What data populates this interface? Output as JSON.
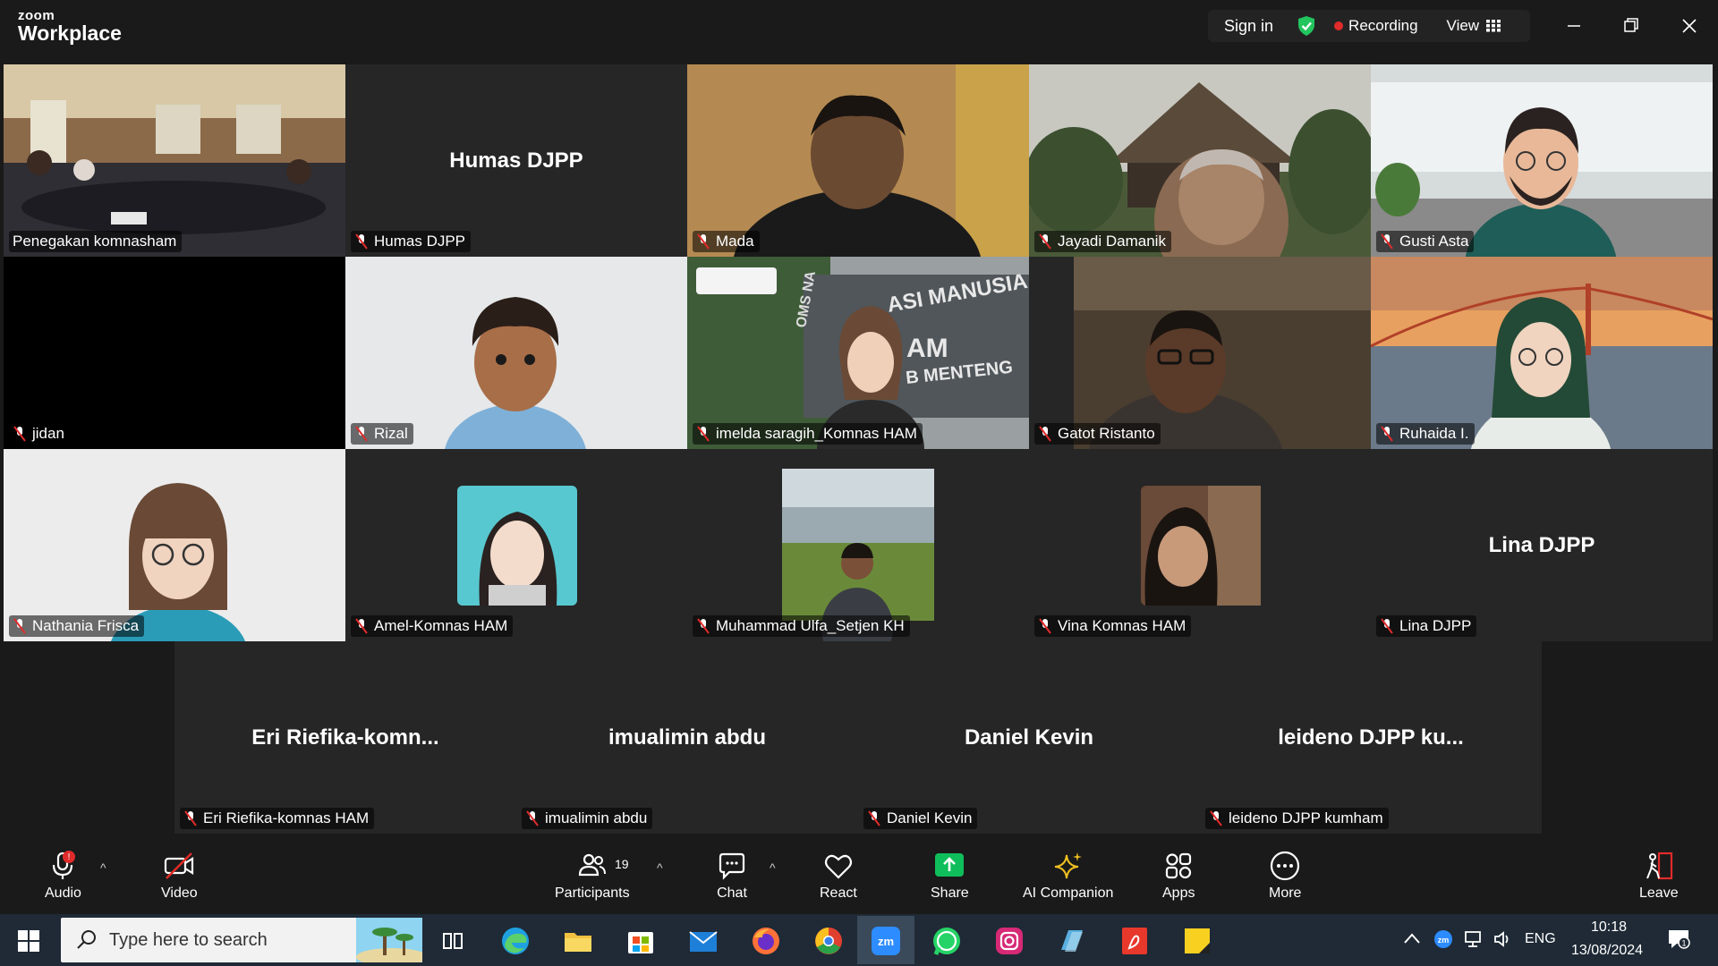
{
  "app": {
    "brand_small": "zoom",
    "brand_big": "Workplace"
  },
  "topbar": {
    "sign_in": "Sign in",
    "recording": "Recording",
    "view": "View"
  },
  "tiles": [
    {
      "name": "Penegakan komnasham",
      "big": "",
      "active": true
    },
    {
      "name": "Humas DJPP",
      "big": "Humas DJPP"
    },
    {
      "name": "Mada",
      "big": ""
    },
    {
      "name": "Jayadi Damanik",
      "big": ""
    },
    {
      "name": "Gusti Asta",
      "big": ""
    },
    {
      "name": "jidan",
      "big": ""
    },
    {
      "name": "Rizal",
      "big": ""
    },
    {
      "name": "imelda saragih_Komnas HAM",
      "big": ""
    },
    {
      "name": "Gatot Ristanto",
      "big": ""
    },
    {
      "name": "Ruhaida I.",
      "big": ""
    },
    {
      "name": "Nathania Frisca",
      "big": ""
    },
    {
      "name": "Amel-Komnas HAM",
      "big": ""
    },
    {
      "name": "Muhammad Ulfa_Setjen KH",
      "big": ""
    },
    {
      "name": "Vina Komnas HAM",
      "big": ""
    },
    {
      "name": "Lina DJPP",
      "big": "Lina DJPP"
    }
  ],
  "bottom_tiles": [
    {
      "name": "Eri Riefika-komnas HAM",
      "big": "Eri  Riefika-komn..."
    },
    {
      "name": "imualimin abdu",
      "big": "imualimin abdu"
    },
    {
      "name": "Daniel Kevin",
      "big": "Daniel Kevin"
    },
    {
      "name": "leideno DJPP kumham",
      "big": "leideno DJPP  ku..."
    }
  ],
  "imelda_sign": {
    "line1": "ASI MANUSIA",
    "line2": "AM",
    "line3": "B MENTENG",
    "left": "OMS NA"
  },
  "toolbar": {
    "audio": "Audio",
    "video": "Video",
    "participants": "Participants",
    "participants_count": "19",
    "chat": "Chat",
    "react": "React",
    "share": "Share",
    "ai": "AI Companion",
    "apps": "Apps",
    "more": "More",
    "leave": "Leave"
  },
  "taskbar": {
    "search_placeholder": "Type here to search",
    "lang": "ENG",
    "time": "10:18",
    "date": "13/08/2024"
  },
  "colors": {
    "active_border": "#22c55e",
    "share_green": "#0fbe5a",
    "recording_red": "#e02b2b",
    "taskbar": "#1f2a36"
  }
}
